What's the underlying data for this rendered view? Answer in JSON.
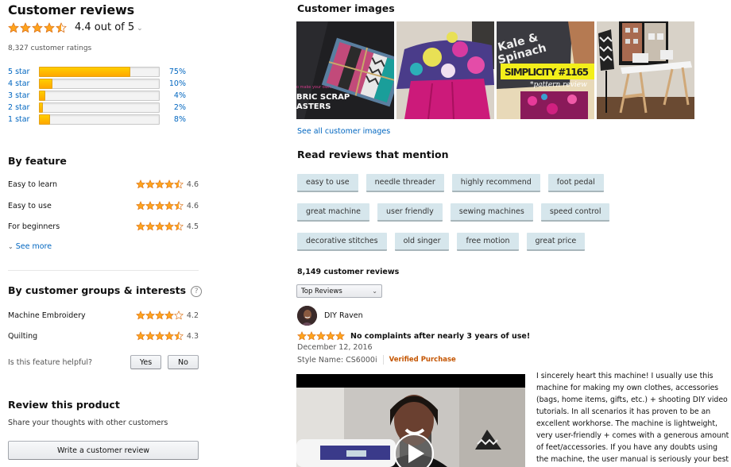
{
  "summary": {
    "title": "Customer reviews",
    "rating": 4.4,
    "rating_text": "4.4 out of 5",
    "ratings_count": "8,327 customer ratings",
    "star_color": "#ffa41c",
    "histogram": [
      {
        "label": "5 star",
        "percent": 75,
        "percent_text": "75%"
      },
      {
        "label": "4 star",
        "percent": 10,
        "percent_text": "10%"
      },
      {
        "label": "3 star",
        "percent": 4,
        "percent_text": "4%"
      },
      {
        "label": "2 star",
        "percent": 2,
        "percent_text": "2%"
      },
      {
        "label": "1 star",
        "percent": 8,
        "percent_text": "8%"
      }
    ]
  },
  "by_feature": {
    "title": "By feature",
    "items": [
      {
        "label": "Easy to learn",
        "rating": 4.6,
        "rating_text": "4.6"
      },
      {
        "label": "Easy to use",
        "rating": 4.6,
        "rating_text": "4.6"
      },
      {
        "label": "For beginners",
        "rating": 4.5,
        "rating_text": "4.5"
      }
    ],
    "see_more": "See more"
  },
  "by_groups": {
    "title": "By customer groups & interests",
    "help_icon": "?",
    "items": [
      {
        "label": "Machine Embroidery",
        "rating": 4.2,
        "rating_text": "4.2"
      },
      {
        "label": "Quilting",
        "rating": 4.3,
        "rating_text": "4.3"
      }
    ],
    "helpful_question": "Is this feature helpful?",
    "yes_label": "Yes",
    "no_label": "No"
  },
  "review_product": {
    "title": "Review this product",
    "subtitle": "Share your thoughts with other customers",
    "button": "Write a customer review"
  },
  "customer_images": {
    "title": "Customer images",
    "images": [
      {
        "caption_small": "o make your own:",
        "caption_line1": "BRIC SCRAP",
        "caption_line2": "ASTERS"
      },
      {
        "caption": ""
      },
      {
        "banner": "SIMPLICITY #1165",
        "subtitle": "*pattern review",
        "shirt_text": "Kale & Spinach"
      },
      {
        "caption": ""
      }
    ],
    "see_all": "See all customer images"
  },
  "mentions": {
    "title": "Read reviews that mention",
    "rows": [
      [
        "easy to use",
        "needle threader",
        "highly recommend",
        "foot pedal"
      ],
      [
        "great machine",
        "user friendly",
        "sewing machines",
        "speed control"
      ],
      [
        "decorative stitches",
        "old singer",
        "free motion",
        "great price"
      ]
    ]
  },
  "reviews": {
    "count": "8,149 customer reviews",
    "sort_selected": "Top Reviews",
    "items": [
      {
        "author": "DIY Raven",
        "rating": 5,
        "title": "No complaints after nearly 3 years of use!",
        "date": "December 12, 2016",
        "style": "Style Name: CS6000i",
        "verified": "Verified Purchase",
        "body": "I sincerely heart this machine! I usually use this machine for making my own clothes, accessories (bags, home items, gifts, etc.) + shooting DIY video tutorials. In all scenarios it has proven to be an excellent workhorse. The machine is lightweight, very user-friendly + comes with a generous amount of feet/accessories. If you have any doubts using the machine, the user manual is seriously your best"
      }
    ]
  }
}
